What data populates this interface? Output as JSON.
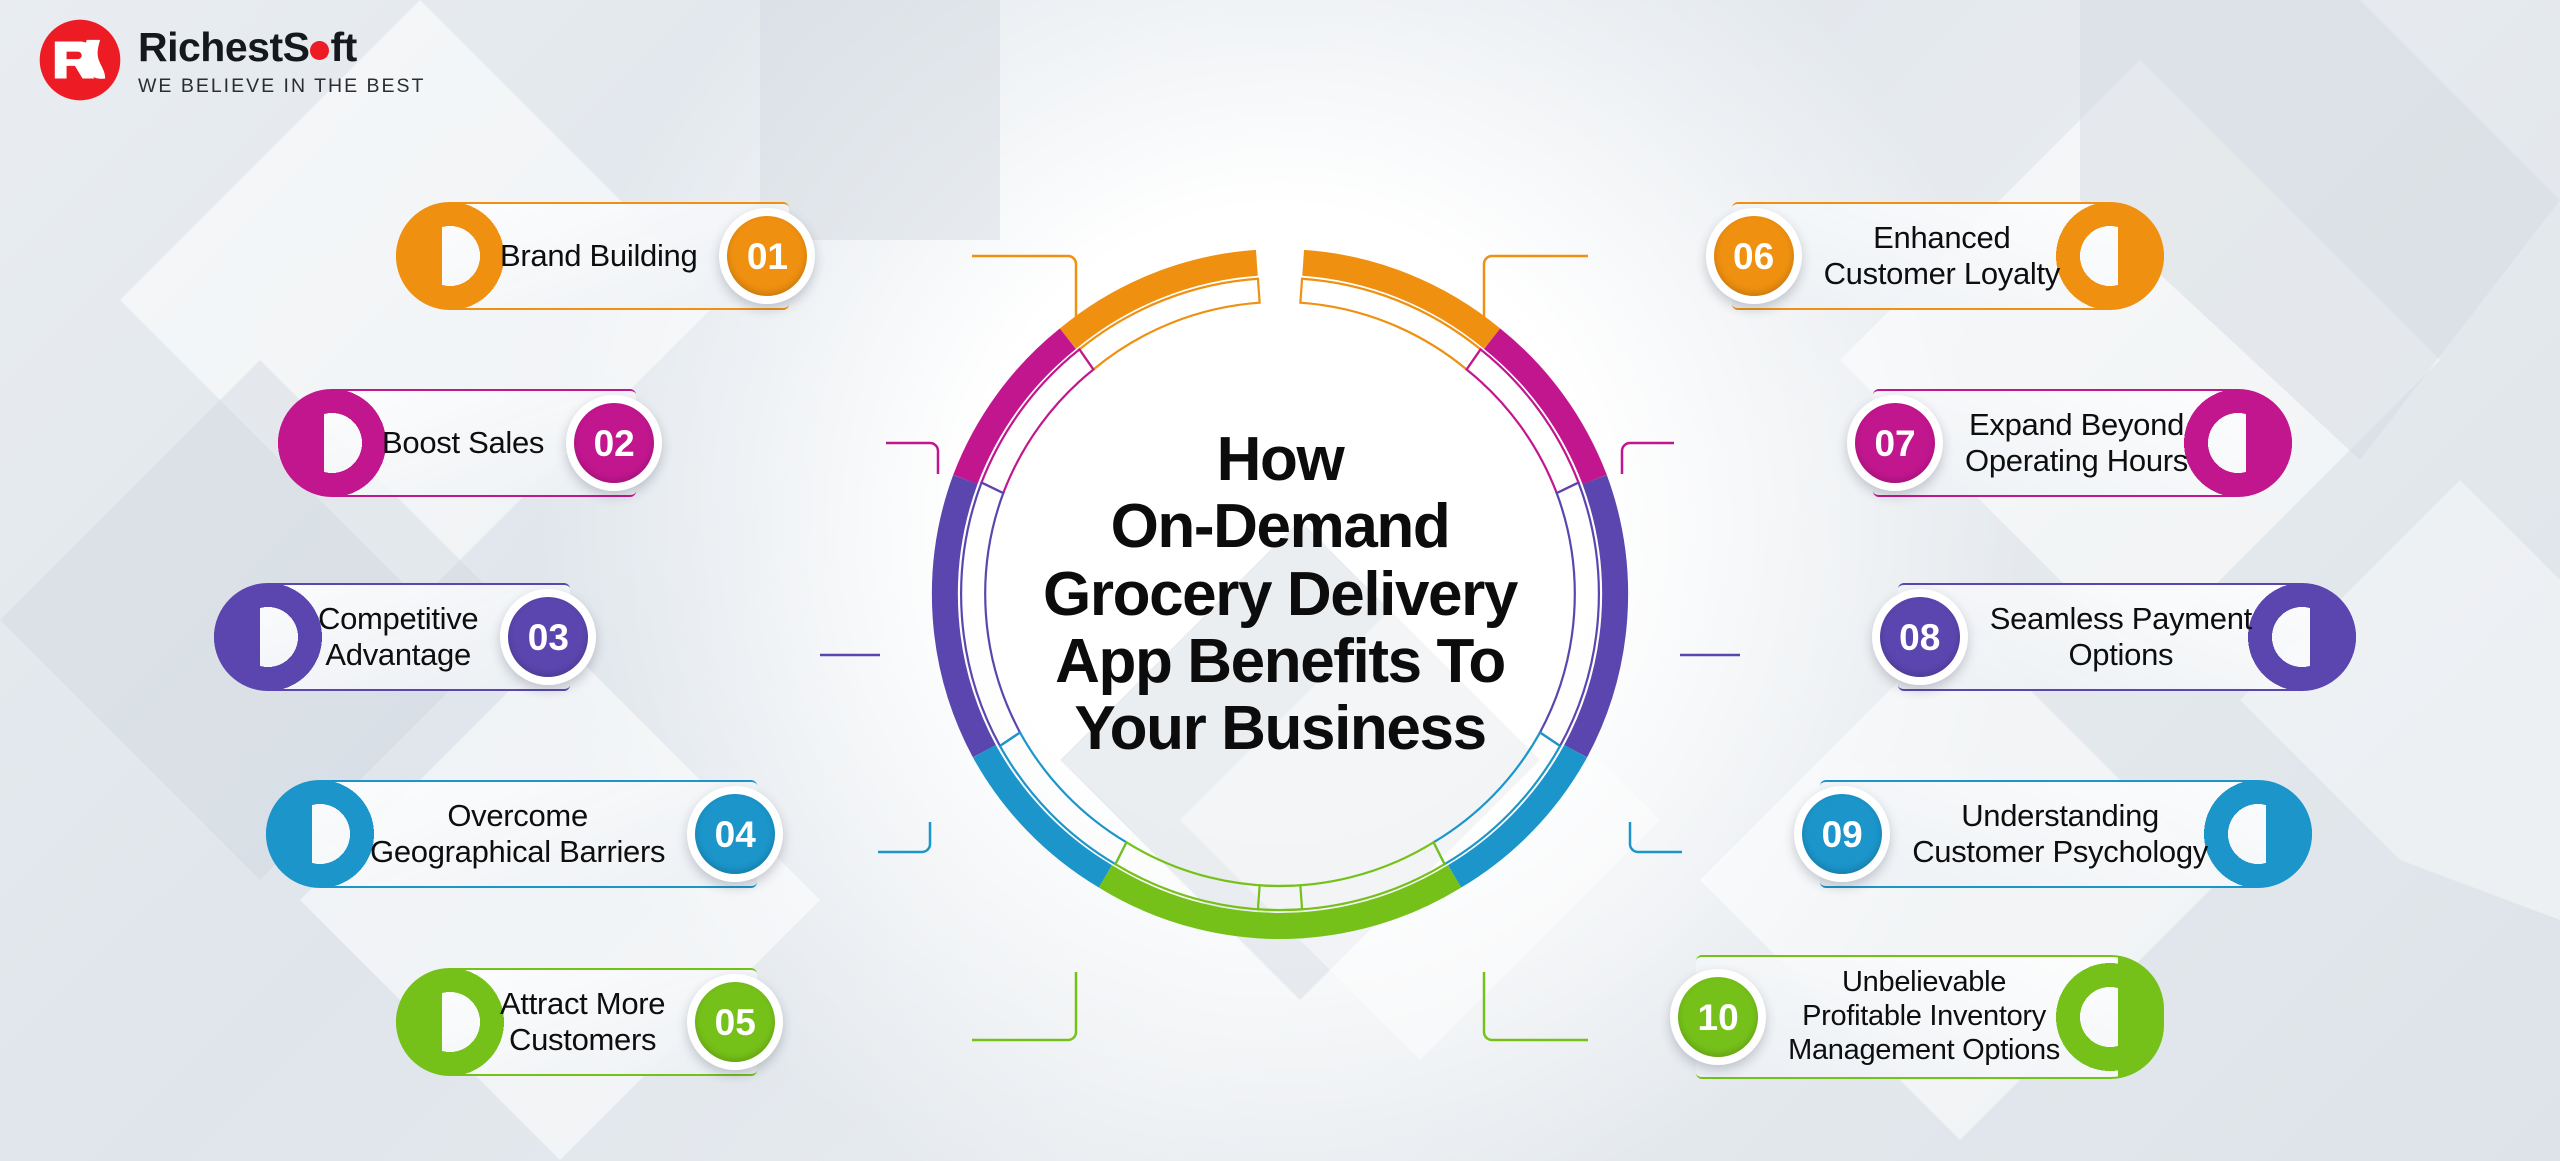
{
  "brand": {
    "name_part1": "RichestS",
    "name_part2": "ft",
    "tagline": "WE BELIEVE IN THE BEST",
    "mark_color": "#ed1c24",
    "mark_letters": "RS"
  },
  "center": {
    "title_lines": [
      "How",
      "On-Demand",
      "Grocery Delivery",
      "App Benefits To",
      "Your Business"
    ]
  },
  "palette": {
    "orange": "#ef9010",
    "magenta": "#c2168f",
    "purple": "#5b46af",
    "blue": "#1b95ca",
    "green": "#76c119",
    "background": "#e4e9ee",
    "text": "#0e0e0e"
  },
  "items": [
    {
      "number": "01",
      "label": "Brand Building",
      "color": "#ef9010",
      "side": "left"
    },
    {
      "number": "02",
      "label": "Boost Sales",
      "color": "#c2168f",
      "side": "left"
    },
    {
      "number": "03",
      "label": "Competitive\nAdvantage",
      "color": "#5b46af",
      "side": "left"
    },
    {
      "number": "04",
      "label": "Overcome\nGeographical Barriers",
      "color": "#1b95ca",
      "side": "left"
    },
    {
      "number": "05",
      "label": "Attract More\nCustomers",
      "color": "#76c119",
      "side": "left"
    },
    {
      "number": "06",
      "label": "Enhanced\nCustomer Loyalty",
      "color": "#ef9010",
      "side": "right"
    },
    {
      "number": "07",
      "label": "Expand Beyond\nOperating Hours",
      "color": "#c2168f",
      "side": "right"
    },
    {
      "number": "08",
      "label": "Seamless Payment\nOptions",
      "color": "#5b46af",
      "side": "right"
    },
    {
      "number": "09",
      "label": "Understanding\nCustomer Psychology",
      "color": "#1b95ca",
      "side": "right"
    },
    {
      "number": "10",
      "label": "Unbelievable\nProfitable Inventory\nManagement Options",
      "color": "#76c119",
      "side": "right"
    }
  ],
  "ring": {
    "segments_left": [
      "#ef9010",
      "#c2168f",
      "#5b46af",
      "#1b95ca",
      "#76c119"
    ],
    "segments_right": [
      "#ef9010",
      "#c2168f",
      "#5b46af",
      "#1b95ca",
      "#76c119"
    ]
  }
}
